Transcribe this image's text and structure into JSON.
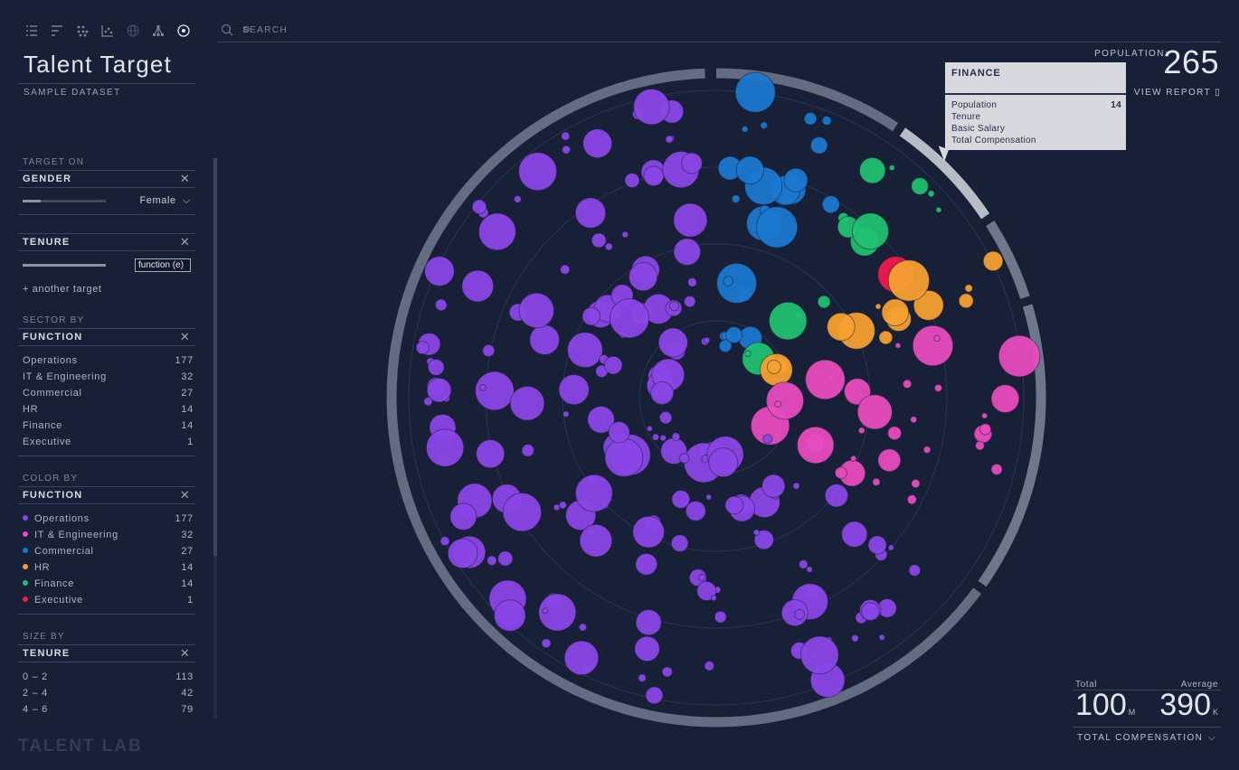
{
  "toolbar": {
    "icons": [
      "list-icon",
      "bars-icon",
      "clusters-icon",
      "scatter-icon",
      "globe-icon",
      "hierarchy-icon",
      "target-icon"
    ]
  },
  "app": {
    "title": "Talent Target",
    "subtitle": "SAMPLE DATASET",
    "brand": "TALENT LAB"
  },
  "target_on": {
    "caption": "TARGET ON",
    "gender": {
      "label": "GENDER",
      "value": "Female"
    },
    "tenure": {
      "label": "TENURE",
      "input_value": "function (e)"
    },
    "add_label": "+ another target"
  },
  "sector_by": {
    "caption": "SECTOR BY",
    "label": "FUNCTION",
    "items": [
      {
        "name": "Operations",
        "count": "177"
      },
      {
        "name": "IT & Engineering",
        "count": "32"
      },
      {
        "name": "Commercial",
        "count": "27"
      },
      {
        "name": "HR",
        "count": "14"
      },
      {
        "name": "Finance",
        "count": "14"
      },
      {
        "name": "Executive",
        "count": "1"
      }
    ]
  },
  "color_by": {
    "caption": "COLOR BY",
    "label": "FUNCTION",
    "items": [
      {
        "name": "Operations",
        "count": "177",
        "color": "#8a46e6"
      },
      {
        "name": "IT & Engineering",
        "count": "32",
        "color": "#e84bbf"
      },
      {
        "name": "Commercial",
        "count": "27",
        "color": "#1b78d0"
      },
      {
        "name": "HR",
        "count": "14",
        "color": "#f5a030"
      },
      {
        "name": "Finance",
        "count": "14",
        "color": "#20c070"
      },
      {
        "name": "Executive",
        "count": "1",
        "color": "#f0194e"
      }
    ]
  },
  "size_by": {
    "caption": "SIZE BY",
    "label": "TENURE",
    "items": [
      {
        "name": "0 – 2",
        "count": "113"
      },
      {
        "name": "2 – 4",
        "count": "42"
      },
      {
        "name": "4 – 6",
        "count": "79"
      }
    ]
  },
  "search": {
    "placeholder": "SEARCH"
  },
  "population": {
    "label": "POPULATION:",
    "value": "265"
  },
  "view_report": "VIEW REPORT",
  "tooltip": {
    "title": "FINANCE",
    "rows": [
      {
        "label": "Population",
        "value": "14"
      },
      {
        "label": "Tenure",
        "value": ""
      },
      {
        "label": "Basic Salary",
        "value": ""
      },
      {
        "label": "Total Compensation",
        "value": ""
      }
    ]
  },
  "stats": {
    "total_label": "Total",
    "total_value": "100",
    "total_unit": "M",
    "avg_label": "Average",
    "avg_value": "390",
    "avg_unit": "K",
    "metric": "TOTAL COMPENSATION"
  },
  "colors": {
    "Operations": "#8a46e6",
    "IT & Engineering": "#e84bbf",
    "Commercial": "#1b78d0",
    "HR": "#f5a030",
    "Finance": "#20c070",
    "Executive": "#f0194e"
  }
}
